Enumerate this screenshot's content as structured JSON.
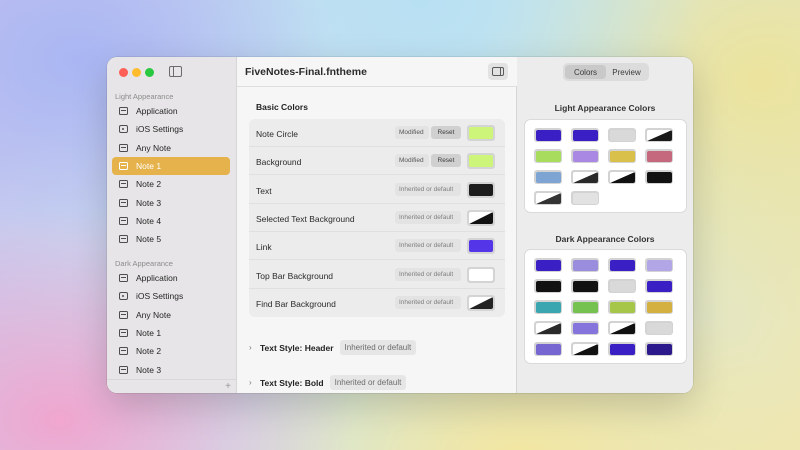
{
  "window": {
    "title": "FiveNotes-Final.fntheme"
  },
  "sidebar": {
    "light_section": "Light Appearance",
    "light_items": [
      {
        "label": "Application",
        "icon": "app-window-icon"
      },
      {
        "label": "iOS Settings",
        "icon": "device-icon"
      },
      {
        "label": "Any Note",
        "icon": "note-icon"
      },
      {
        "label": "Note 1",
        "icon": "note-icon",
        "selected": true
      },
      {
        "label": "Note 2",
        "icon": "note-icon"
      },
      {
        "label": "Note 3",
        "icon": "note-icon"
      },
      {
        "label": "Note 4",
        "icon": "note-icon"
      },
      {
        "label": "Note 5",
        "icon": "note-icon"
      }
    ],
    "dark_section": "Dark Appearance",
    "dark_items": [
      {
        "label": "Application",
        "icon": "app-window-icon"
      },
      {
        "label": "iOS Settings",
        "icon": "device-icon"
      },
      {
        "label": "Any Note",
        "icon": "note-icon"
      },
      {
        "label": "Note 1",
        "icon": "note-icon"
      },
      {
        "label": "Note 2",
        "icon": "note-icon"
      },
      {
        "label": "Note 3",
        "icon": "note-icon"
      }
    ],
    "add_label": "+"
  },
  "main": {
    "group_title": "Basic Colors",
    "rows": [
      {
        "label": "Note Circle",
        "status": "Modified",
        "reset": "Reset",
        "color": "#cdf57a"
      },
      {
        "label": "Background",
        "status": "Modified",
        "reset": "Reset",
        "color": "#cdf57a"
      },
      {
        "label": "Text",
        "status": "Inherited or default",
        "color": "#1c1c1c"
      },
      {
        "label": "Selected Text Background",
        "status": "Inherited or default",
        "color": "split",
        "split_colors": [
          "#ffffff",
          "#111111"
        ]
      },
      {
        "label": "Link",
        "status": "Inherited or default",
        "color": "#5436e8"
      },
      {
        "label": "Top Bar Background",
        "status": "Inherited or default",
        "color": "#ffffff"
      },
      {
        "label": "Find Bar Background",
        "status": "Inherited or default",
        "color": "split",
        "split_colors": [
          "#ffffff",
          "#222222"
        ]
      }
    ],
    "collapsed_groups": [
      {
        "title": "Text Style: Header",
        "status": "Inherited or default"
      },
      {
        "title": "Text Style: Bold",
        "status": "Inherited or default"
      }
    ]
  },
  "inspector": {
    "tabs": [
      "Colors",
      "Preview"
    ],
    "active_tab": "Colors",
    "light_title": "Light Appearance Colors",
    "light_colors": [
      "#3a1fc4",
      "#3a1fc4",
      "#d9d9d9",
      "split:#ffffff|#1a1a1a",
      "#a7dc5c",
      "#a988e3",
      "#d9c04a",
      "#c5687e",
      "#7ea4d4",
      "split:#ffffff|#2a2a2a",
      "split:#ffffff|#111111",
      "#111111",
      "split:#ffffff|#333333",
      "#e2e2e2"
    ],
    "dark_title": "Dark Appearance Colors",
    "dark_colors": [
      "#3a1fc4",
      "#9a8ddd",
      "#3a1fc4",
      "#b3a6e6",
      "#111111",
      "#111111",
      "#d9d9d9",
      "#3a1fc4",
      "#3aa6b0",
      "#76c250",
      "#a6c64a",
      "#d4b040",
      "split:#ffffff|#2a2a2a",
      "#8474dc",
      "split:#ffffff|#111111",
      "#d9d9d9",
      "#7666d2",
      "split:#ffffff|#111111",
      "#3a1fc4",
      "#2c1a8c"
    ]
  }
}
